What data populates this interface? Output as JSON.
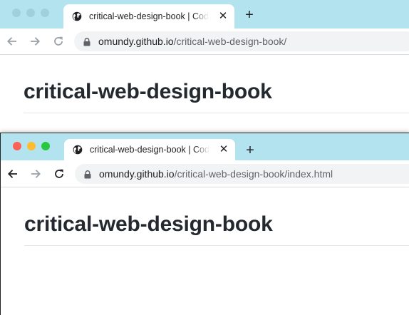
{
  "colors": {
    "tabstrip": "#b3e3ee",
    "traffic_close": "#fe5f57",
    "traffic_minimize": "#febc2e",
    "traffic_zoom": "#28c840",
    "heading_text": "#24292f"
  },
  "windows": [
    {
      "focused": false,
      "tab": {
        "icon": "globe-icon",
        "title": "critical-web-design-book | Code",
        "close_icon": "close-icon"
      },
      "new_tab_icon": "plus-icon",
      "toolbar": {
        "back_icon": "arrow-left-icon",
        "forward_icon": "arrow-right-icon",
        "reload_icon": "reload-icon",
        "address": {
          "lock_icon": "lock-icon",
          "domain": "omundy.github.io",
          "path": "/critical-web-design-book/"
        }
      },
      "page": {
        "heading": "critical-web-design-book"
      }
    },
    {
      "focused": true,
      "tab": {
        "icon": "globe-icon",
        "title": "critical-web-design-book | Code",
        "close_icon": "close-icon"
      },
      "new_tab_icon": "plus-icon",
      "toolbar": {
        "back_icon": "arrow-left-icon",
        "forward_icon": "arrow-right-icon",
        "reload_icon": "reload-icon",
        "address": {
          "lock_icon": "lock-icon",
          "domain": "omundy.github.io",
          "path": "/critical-web-design-book/index.html"
        }
      },
      "page": {
        "heading": "critical-web-design-book"
      }
    }
  ]
}
